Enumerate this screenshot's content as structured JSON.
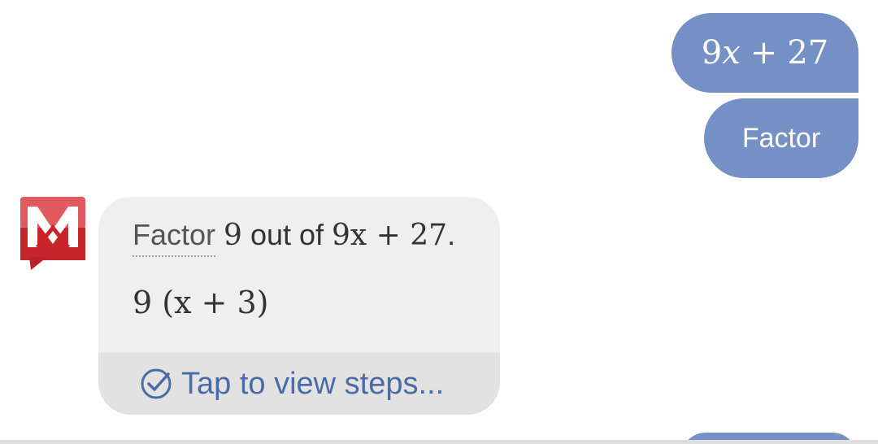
{
  "user_messages": {
    "expression": {
      "coef": "9",
      "var": "x",
      "op": "+",
      "const": "27"
    },
    "command": "Factor"
  },
  "answer": {
    "step_verb": "Factor",
    "step_factor": "9",
    "step_mid": "out of",
    "step_expr": "9x + 27",
    "step_end": ".",
    "result": "9 (x + 3)",
    "steps_button": "Tap to view steps..."
  },
  "colors": {
    "user_bubble": "#7490c4",
    "answer_card": "#efefef",
    "steps_bar": "#e2e2e2",
    "steps_link": "#4a6ba7",
    "logo_red": "#c8242b"
  }
}
